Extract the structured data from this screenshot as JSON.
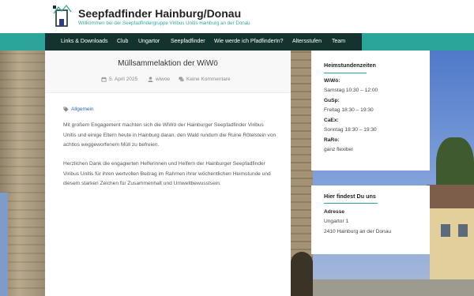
{
  "site": {
    "title": "Seepfadfinder Hainburg/Donau",
    "tagline": "Willkommen bei der Seepfadfindergruppe Viribus Unitis Hainburg an der Donau"
  },
  "nav": {
    "items": [
      "Links & Downloads",
      "Club",
      "Ungartor",
      "Seepfadfinder",
      "Wie werde ich PfadfinderIn?",
      "Altersstufen",
      "Team"
    ]
  },
  "post": {
    "title": "Müllsammelaktion der WiWö",
    "date": "5. April 2025",
    "author": "wiwoe",
    "comments": "Keine Kommentare",
    "category": "Allgemein",
    "paragraph1": "Mit großem Engagement machten sich die WiWö der Hainburger Seepfadfinder Viribus Unitis und einige Eltern heute in Hainburg daran, den Wald rundum die Ruine Rötelstein von achtlos weggeworfenem Müll zu befreien.",
    "paragraph2": "Herzlichen Dank die engagierten Helferinnen und Helfern der Hainburger Seepfadfinder Viribus Unitis für ihren wertvollen Beitrag im Rahmen ihrer wöchentlichen Heimstunde und diesem starken Zeichen für Zusammenhalt und Umweltbewusstsein."
  },
  "sidebar": {
    "hours": {
      "title": "Heimstundenzeiten",
      "rows": [
        {
          "label": "WiWö:",
          "value": "Samstag 10:30 – 12:00"
        },
        {
          "label": "GuSp:",
          "value": "Freitag 18:30 – 19:30"
        },
        {
          "label": "CaEx:",
          "value": "Sonntag 18:30 – 19:30"
        },
        {
          "label": "RaRo:",
          "value": "ganz flexibel"
        }
      ]
    },
    "location": {
      "title": "Hier findest Du uns",
      "label": "Adresse",
      "street": "Ungartor 1",
      "city": "2410 Hainburg an der Donau"
    }
  },
  "colors": {
    "accent": "#2ba59a",
    "nav_dark": "#14332f",
    "link": "#2a67b8"
  },
  "icons": {
    "date": "calendar-icon",
    "author": "user-icon",
    "comments": "comments-icon",
    "category": "tag-icon"
  }
}
